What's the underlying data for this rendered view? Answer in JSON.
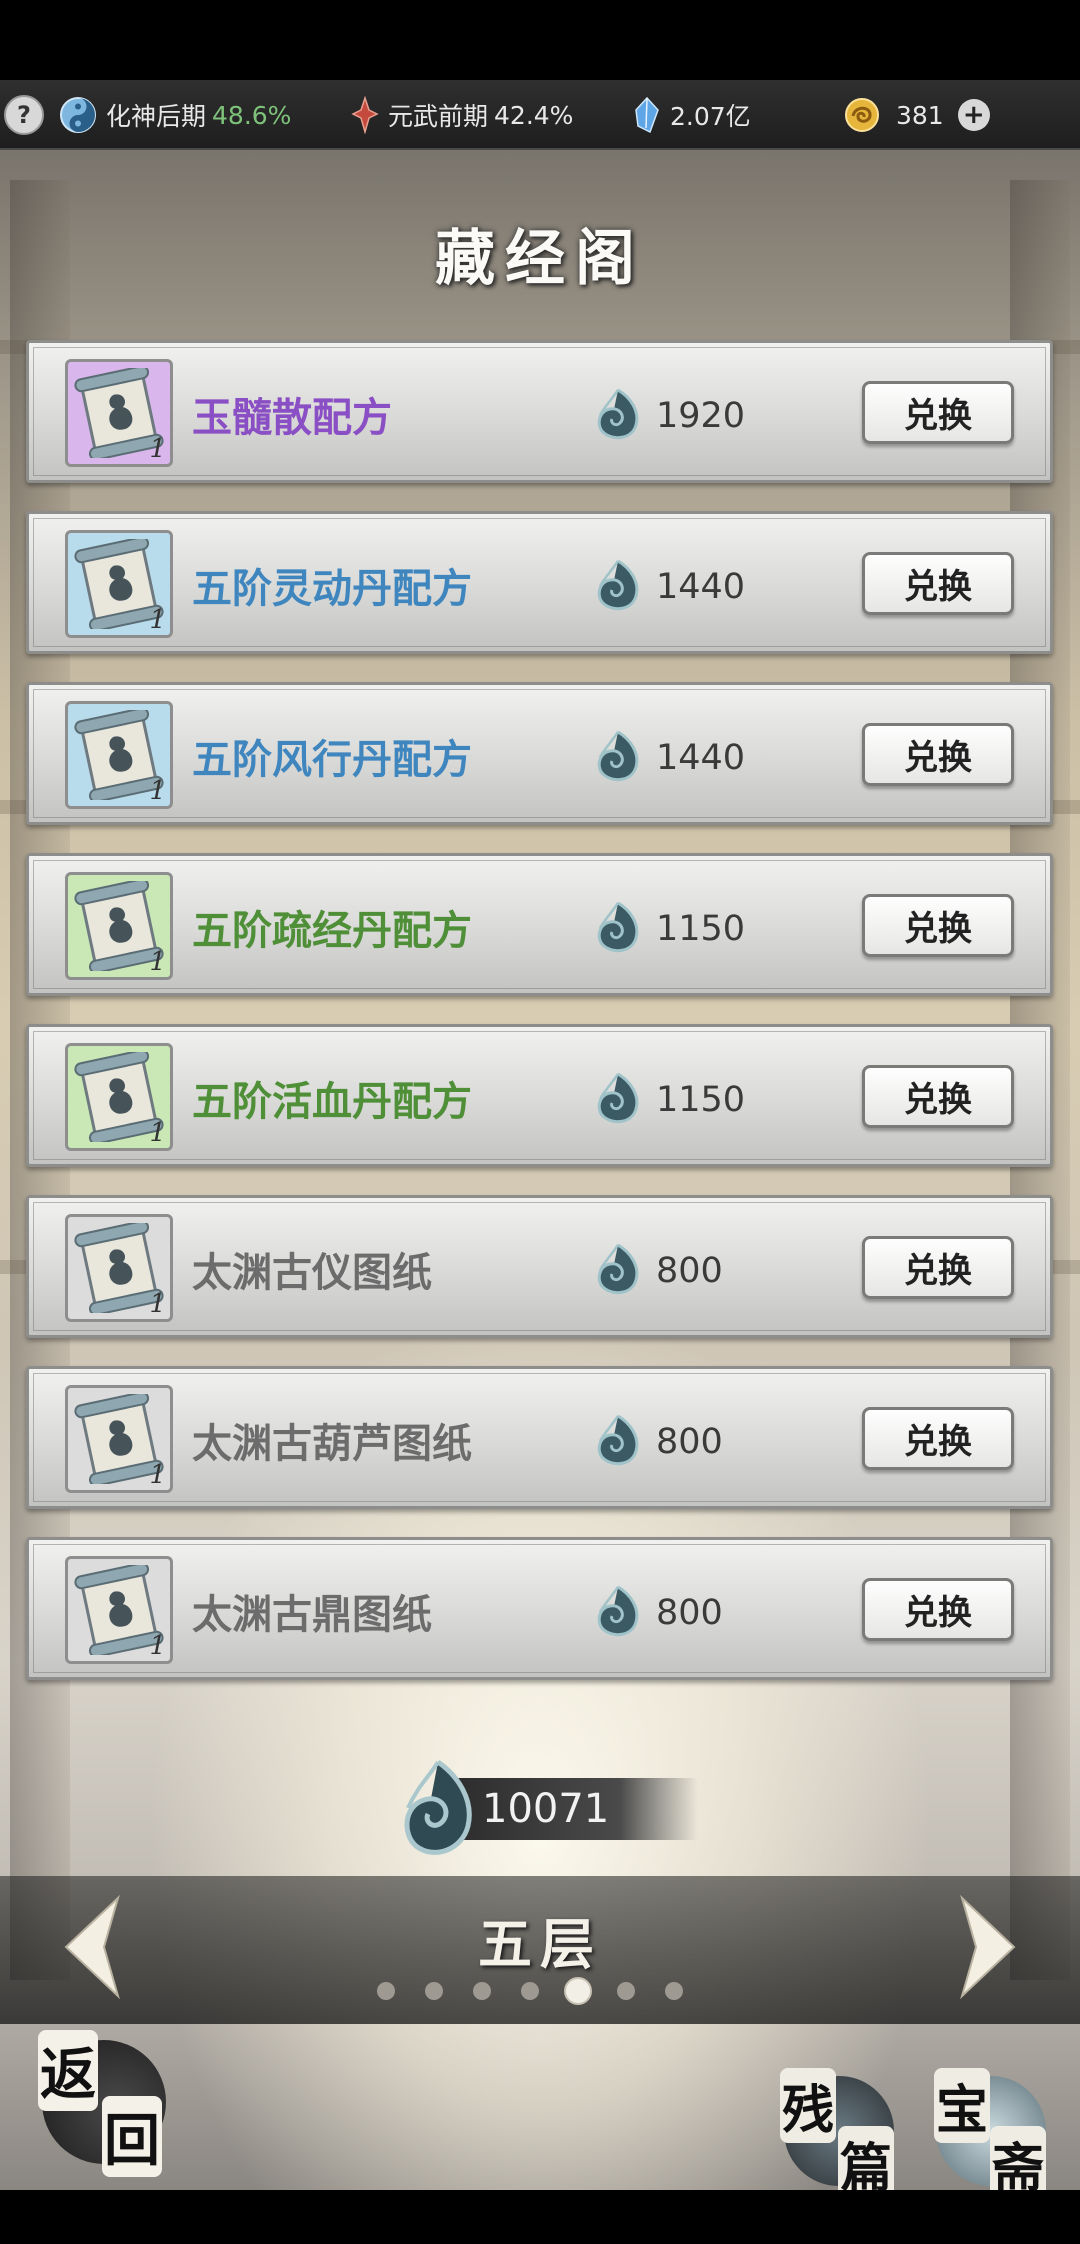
{
  "status_bar": {
    "realm": "化神后期",
    "realm_progress": "48.6%",
    "martial": "元武前期",
    "martial_progress": "42.4%",
    "spirit_stones": "2.07亿",
    "gold": "381"
  },
  "page_title": "藏经阁",
  "items": [
    {
      "name": "玉髓散配方",
      "cost": "1920",
      "qty": "1",
      "exchange_label": "兑换",
      "name_color": "#8a4fc4",
      "box_color": "#d9b6ec"
    },
    {
      "name": "五阶灵动丹配方",
      "cost": "1440",
      "qty": "1",
      "exchange_label": "兑换",
      "name_color": "#3f86bf",
      "box_color": "#b9dced"
    },
    {
      "name": "五阶风行丹配方",
      "cost": "1440",
      "qty": "1",
      "exchange_label": "兑换",
      "name_color": "#3f86bf",
      "box_color": "#b9dced"
    },
    {
      "name": "五阶疏经丹配方",
      "cost": "1150",
      "qty": "1",
      "exchange_label": "兑换",
      "name_color": "#4f8f38",
      "box_color": "#c9e8b5"
    },
    {
      "name": "五阶活血丹配方",
      "cost": "1150",
      "qty": "1",
      "exchange_label": "兑换",
      "name_color": "#4f8f38",
      "box_color": "#c9e8b5"
    },
    {
      "name": "太渊古仪图纸",
      "cost": "800",
      "qty": "1",
      "exchange_label": "兑换",
      "name_color": "#6c6c6c",
      "box_color": "#dcdcdc"
    },
    {
      "name": "太渊古葫芦图纸",
      "cost": "800",
      "qty": "1",
      "exchange_label": "兑换",
      "name_color": "#6c6c6c",
      "box_color": "#dcdcdc"
    },
    {
      "name": "太渊古鼎图纸",
      "cost": "800",
      "qty": "1",
      "exchange_label": "兑换",
      "name_color": "#6c6c6c",
      "box_color": "#dcdcdc"
    }
  ],
  "total_currency": "10071",
  "floor": {
    "label": "五层",
    "page_count": 7,
    "active_index": 4
  },
  "buttons": {
    "back": [
      "返",
      "回"
    ],
    "fragments": [
      "残",
      "篇"
    ],
    "treasure": [
      "宝",
      "斋"
    ]
  },
  "icons": {
    "help": "question-icon",
    "realm": "yin-yang-icon",
    "martial": "martial-emblem-icon",
    "spirit_stone": "crystal-icon",
    "gold": "gold-coin-icon",
    "add": "plus-icon",
    "cost": "jade-swirl-icon",
    "item": "scroll-icon"
  }
}
